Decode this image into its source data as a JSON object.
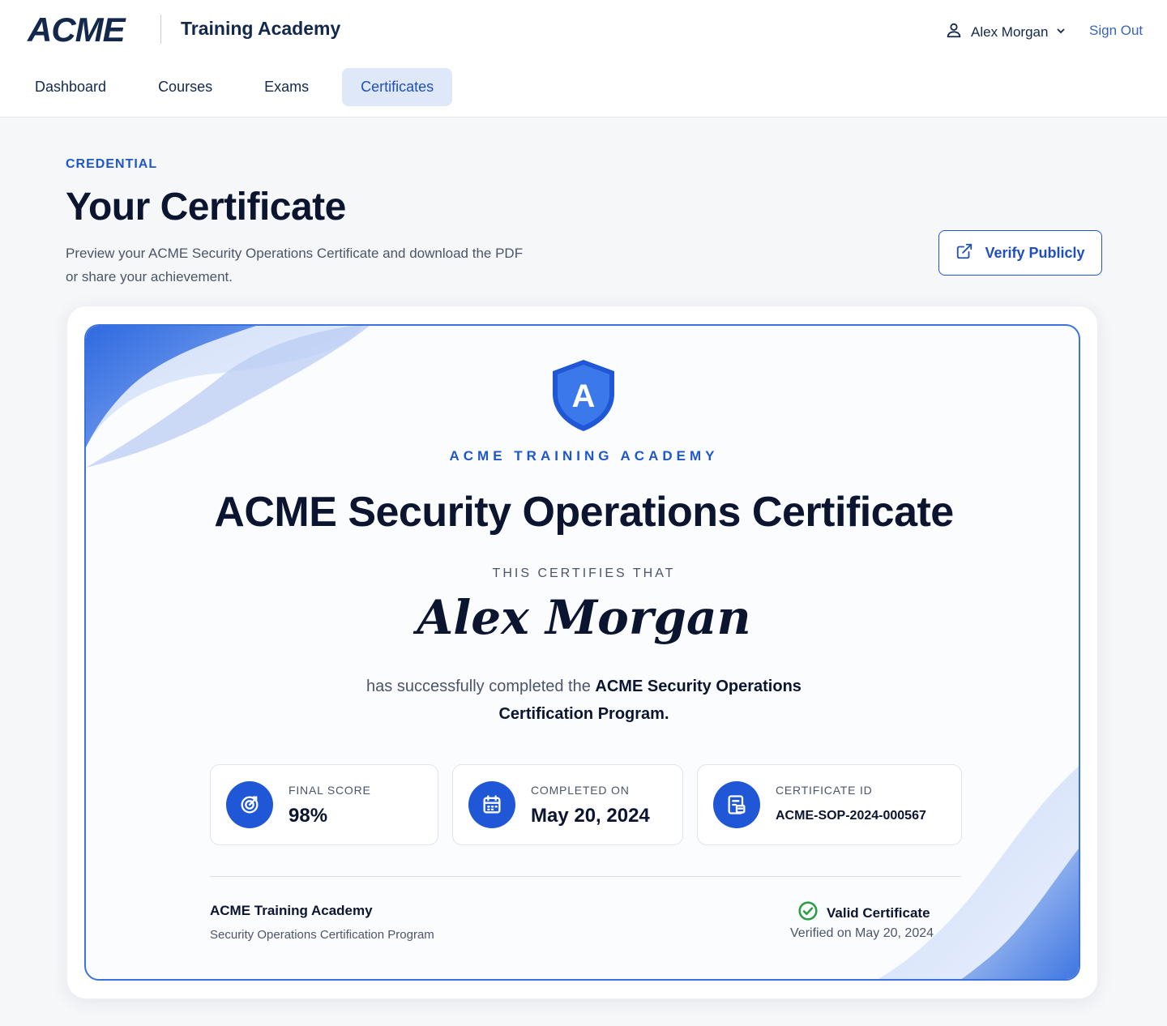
{
  "header": {
    "logo": "ACME",
    "app_title": "Training Academy",
    "user_name": "Alex Morgan",
    "sign_out": "Sign Out"
  },
  "nav": {
    "items": [
      {
        "label": "Dashboard",
        "active": false
      },
      {
        "label": "Courses",
        "active": false
      },
      {
        "label": "Exams",
        "active": false
      },
      {
        "label": "Certificates",
        "active": true
      }
    ]
  },
  "page": {
    "eyebrow": "CREDENTIAL",
    "title": "Your Certificate",
    "description": "Preview your ACME Security Operations Certificate and download the PDF or share your achievement.",
    "verify_button": "Verify Publicly"
  },
  "certificate": {
    "shield_letter": "A",
    "academy": "ACME TRAINING ACADEMY",
    "title": "ACME Security Operations Certificate",
    "certifies": "THIS CERTIFIES THAT",
    "recipient": "Alex Morgan",
    "completed_prefix": "has successfully completed the",
    "program_name": "ACME Security Operations Certification Program.",
    "stats": [
      {
        "label": "FINAL SCORE",
        "value": "98%",
        "icon": "target-icon"
      },
      {
        "label": "COMPLETED ON",
        "value": "May 20, 2024",
        "icon": "calendar-icon"
      },
      {
        "label": "CERTIFICATE ID",
        "value": "ACME-SOP-2024-000567",
        "icon": "id-card-icon"
      }
    ],
    "footer_org": "ACME Training Academy",
    "footer_program": "Security Operations Certification Program",
    "status": "Valid Certificate",
    "verified_on": "Verified on May 20, 2024"
  },
  "colors": {
    "accent": "#1f57c9",
    "navy": "#0b1530",
    "valid_green": "#2e9e46"
  }
}
